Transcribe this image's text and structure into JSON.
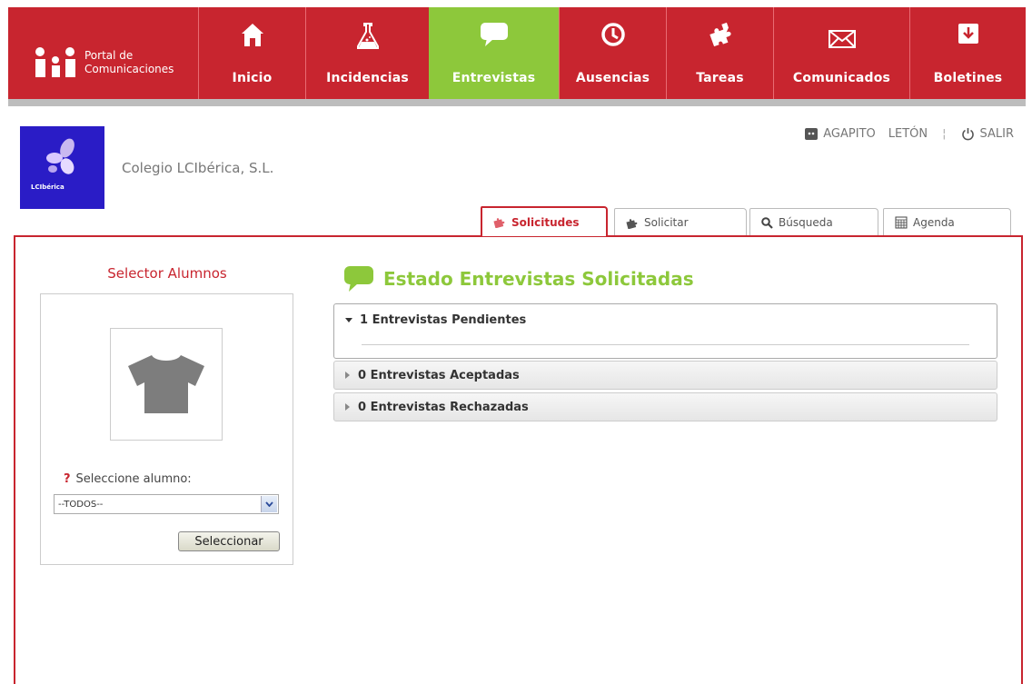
{
  "brand": {
    "line1": "Portal de",
    "line2": "Comunicaciones"
  },
  "nav": [
    {
      "label": "Inicio",
      "icon": "home-icon"
    },
    {
      "label": "Incidencias",
      "icon": "flask-icon"
    },
    {
      "label": "Entrevistas",
      "icon": "speech-bubble-icon",
      "active": true
    },
    {
      "label": "Ausencias",
      "icon": "clock-icon"
    },
    {
      "label": "Tareas",
      "icon": "puzzle-icon"
    },
    {
      "label": "Comunicados",
      "icon": "envelope-icon"
    },
    {
      "label": "Boletines",
      "icon": "download-icon"
    }
  ],
  "school": {
    "name": "Colegio LCIbérica, S.L.",
    "logo_text": "LCIbérica"
  },
  "user": {
    "first": "AGAPITO",
    "last": "LETÓN",
    "logout": "SALIR"
  },
  "tabs": [
    {
      "label": "Solicitudes",
      "active": true
    },
    {
      "label": "Solicitar"
    },
    {
      "label": "Búsqueda"
    },
    {
      "label": "Agenda"
    }
  ],
  "selector": {
    "title": "Selector Alumnos",
    "help_mark": "?",
    "label": "Seleccione alumno:",
    "selected": "--TODOS--",
    "button": "Seleccionar"
  },
  "main": {
    "title": "Estado Entrevistas Solicitadas",
    "sections": [
      {
        "label": "1 Entrevistas Pendientes",
        "expanded": true
      },
      {
        "label": "0 Entrevistas Aceptadas",
        "expanded": false
      },
      {
        "label": "0 Entrevistas Rechazadas",
        "expanded": false
      }
    ]
  },
  "colors": {
    "brand_red": "#c8252f",
    "active_green": "#8dc83b",
    "logo_blue": "#2a1cc6"
  }
}
